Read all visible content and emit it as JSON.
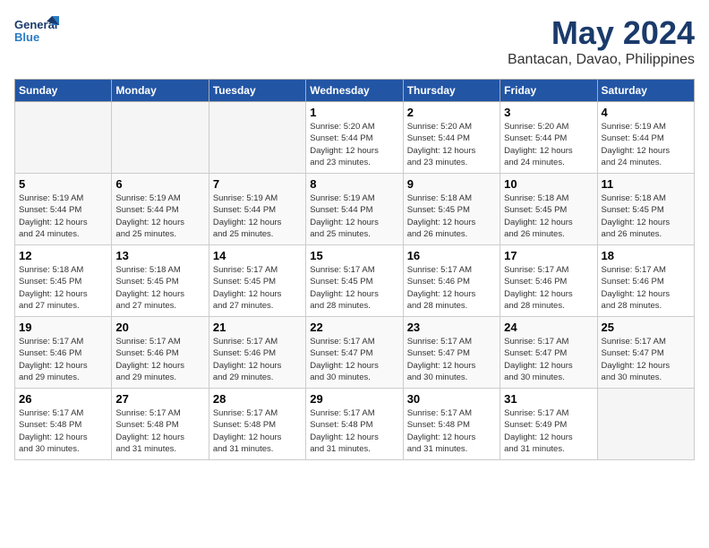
{
  "header": {
    "logo_line1": "General",
    "logo_line2": "Blue",
    "month": "May 2024",
    "location": "Bantacan, Davao, Philippines"
  },
  "weekdays": [
    "Sunday",
    "Monday",
    "Tuesday",
    "Wednesday",
    "Thursday",
    "Friday",
    "Saturday"
  ],
  "weeks": [
    [
      {
        "day": "",
        "info": ""
      },
      {
        "day": "",
        "info": ""
      },
      {
        "day": "",
        "info": ""
      },
      {
        "day": "1",
        "info": "Sunrise: 5:20 AM\nSunset: 5:44 PM\nDaylight: 12 hours\nand 23 minutes."
      },
      {
        "day": "2",
        "info": "Sunrise: 5:20 AM\nSunset: 5:44 PM\nDaylight: 12 hours\nand 23 minutes."
      },
      {
        "day": "3",
        "info": "Sunrise: 5:20 AM\nSunset: 5:44 PM\nDaylight: 12 hours\nand 24 minutes."
      },
      {
        "day": "4",
        "info": "Sunrise: 5:19 AM\nSunset: 5:44 PM\nDaylight: 12 hours\nand 24 minutes."
      }
    ],
    [
      {
        "day": "5",
        "info": "Sunrise: 5:19 AM\nSunset: 5:44 PM\nDaylight: 12 hours\nand 24 minutes."
      },
      {
        "day": "6",
        "info": "Sunrise: 5:19 AM\nSunset: 5:44 PM\nDaylight: 12 hours\nand 25 minutes."
      },
      {
        "day": "7",
        "info": "Sunrise: 5:19 AM\nSunset: 5:44 PM\nDaylight: 12 hours\nand 25 minutes."
      },
      {
        "day": "8",
        "info": "Sunrise: 5:19 AM\nSunset: 5:44 PM\nDaylight: 12 hours\nand 25 minutes."
      },
      {
        "day": "9",
        "info": "Sunrise: 5:18 AM\nSunset: 5:45 PM\nDaylight: 12 hours\nand 26 minutes."
      },
      {
        "day": "10",
        "info": "Sunrise: 5:18 AM\nSunset: 5:45 PM\nDaylight: 12 hours\nand 26 minutes."
      },
      {
        "day": "11",
        "info": "Sunrise: 5:18 AM\nSunset: 5:45 PM\nDaylight: 12 hours\nand 26 minutes."
      }
    ],
    [
      {
        "day": "12",
        "info": "Sunrise: 5:18 AM\nSunset: 5:45 PM\nDaylight: 12 hours\nand 27 minutes."
      },
      {
        "day": "13",
        "info": "Sunrise: 5:18 AM\nSunset: 5:45 PM\nDaylight: 12 hours\nand 27 minutes."
      },
      {
        "day": "14",
        "info": "Sunrise: 5:17 AM\nSunset: 5:45 PM\nDaylight: 12 hours\nand 27 minutes."
      },
      {
        "day": "15",
        "info": "Sunrise: 5:17 AM\nSunset: 5:45 PM\nDaylight: 12 hours\nand 28 minutes."
      },
      {
        "day": "16",
        "info": "Sunrise: 5:17 AM\nSunset: 5:46 PM\nDaylight: 12 hours\nand 28 minutes."
      },
      {
        "day": "17",
        "info": "Sunrise: 5:17 AM\nSunset: 5:46 PM\nDaylight: 12 hours\nand 28 minutes."
      },
      {
        "day": "18",
        "info": "Sunrise: 5:17 AM\nSunset: 5:46 PM\nDaylight: 12 hours\nand 28 minutes."
      }
    ],
    [
      {
        "day": "19",
        "info": "Sunrise: 5:17 AM\nSunset: 5:46 PM\nDaylight: 12 hours\nand 29 minutes."
      },
      {
        "day": "20",
        "info": "Sunrise: 5:17 AM\nSunset: 5:46 PM\nDaylight: 12 hours\nand 29 minutes."
      },
      {
        "day": "21",
        "info": "Sunrise: 5:17 AM\nSunset: 5:46 PM\nDaylight: 12 hours\nand 29 minutes."
      },
      {
        "day": "22",
        "info": "Sunrise: 5:17 AM\nSunset: 5:47 PM\nDaylight: 12 hours\nand 30 minutes."
      },
      {
        "day": "23",
        "info": "Sunrise: 5:17 AM\nSunset: 5:47 PM\nDaylight: 12 hours\nand 30 minutes."
      },
      {
        "day": "24",
        "info": "Sunrise: 5:17 AM\nSunset: 5:47 PM\nDaylight: 12 hours\nand 30 minutes."
      },
      {
        "day": "25",
        "info": "Sunrise: 5:17 AM\nSunset: 5:47 PM\nDaylight: 12 hours\nand 30 minutes."
      }
    ],
    [
      {
        "day": "26",
        "info": "Sunrise: 5:17 AM\nSunset: 5:48 PM\nDaylight: 12 hours\nand 30 minutes."
      },
      {
        "day": "27",
        "info": "Sunrise: 5:17 AM\nSunset: 5:48 PM\nDaylight: 12 hours\nand 31 minutes."
      },
      {
        "day": "28",
        "info": "Sunrise: 5:17 AM\nSunset: 5:48 PM\nDaylight: 12 hours\nand 31 minutes."
      },
      {
        "day": "29",
        "info": "Sunrise: 5:17 AM\nSunset: 5:48 PM\nDaylight: 12 hours\nand 31 minutes."
      },
      {
        "day": "30",
        "info": "Sunrise: 5:17 AM\nSunset: 5:48 PM\nDaylight: 12 hours\nand 31 minutes."
      },
      {
        "day": "31",
        "info": "Sunrise: 5:17 AM\nSunset: 5:49 PM\nDaylight: 12 hours\nand 31 minutes."
      },
      {
        "day": "",
        "info": ""
      }
    ]
  ]
}
